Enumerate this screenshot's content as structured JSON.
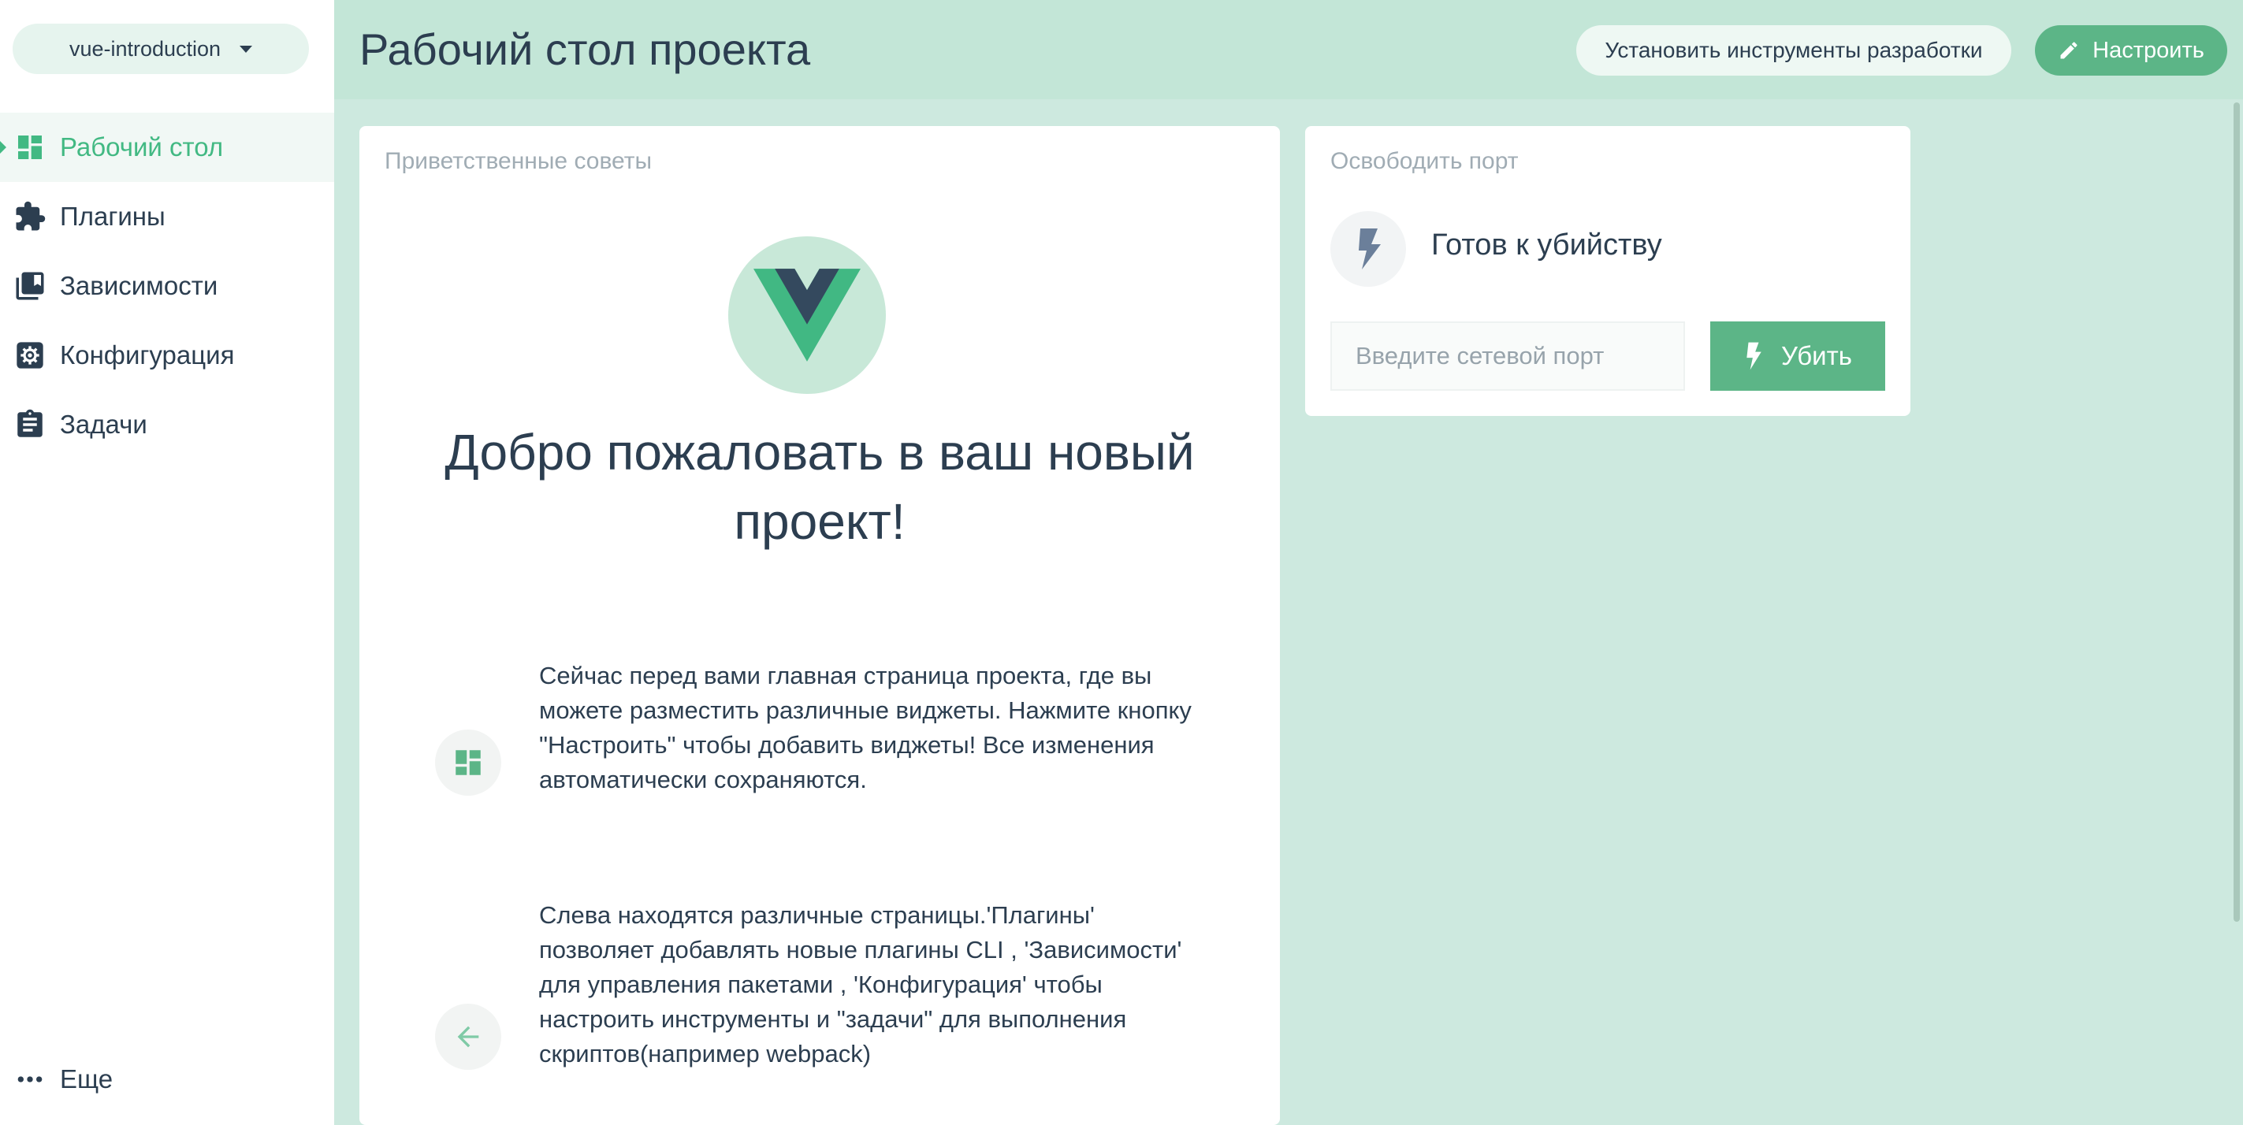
{
  "sidebar": {
    "project_name": "vue-introduction",
    "items": [
      {
        "label": "Рабочий стол",
        "icon": "dashboard-icon",
        "active": true
      },
      {
        "label": "Плагины",
        "icon": "puzzle-icon"
      },
      {
        "label": "Зависимости",
        "icon": "library-books-icon"
      },
      {
        "label": "Конфигурация",
        "icon": "settings-icon"
      },
      {
        "label": "Задачи",
        "icon": "clipboard-icon"
      }
    ],
    "more_label": "Еще"
  },
  "header": {
    "title": "Рабочий стол проекта",
    "devtools_label": "Установить инструменты разработки",
    "customize_label": "Настроить"
  },
  "welcome_widget": {
    "title": "Приветственные советы",
    "heading_line1": "Добро пожаловать в ваш новый",
    "heading_line2": "проект!",
    "tips": [
      {
        "icon": "dashboard-icon",
        "text": "Сейчас перед вами главная страница проекта, где вы можете разместить различные виджеты. Нажмите кнопку \"Настроить\" чтобы добавить виджеты! Все изменения автоматически сохраняются."
      },
      {
        "icon": "arrow-left-icon",
        "text": "Слева находятся различные страницы.'Плагины' позволяет добавлять новые плагины CLI , 'Зависимости' для управления пакетами , 'Конфигурация' чтобы настроить инструменты и \"задачи\" для выполнения скриптов(например webpack)"
      }
    ]
  },
  "port_widget": {
    "title": "Освободить порт",
    "status": "Готов к убийству",
    "input_value": "",
    "input_placeholder": "Введите сетевой порт",
    "kill_label": "Убить"
  },
  "colors": {
    "accent": "#42b983",
    "button_green": "#5cb587",
    "header_bg": "#c3e6d7",
    "content_bg": "#cde9df",
    "text": "#2c3e50"
  }
}
